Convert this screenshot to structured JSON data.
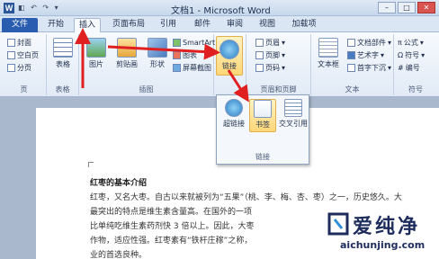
{
  "window": {
    "title": "文档1 - Microsoft Word",
    "app_icon": "W",
    "controls": [
      "–",
      "□",
      "✕"
    ]
  },
  "tabs": [
    {
      "label": "文件"
    },
    {
      "label": "开始"
    },
    {
      "label": "插入"
    },
    {
      "label": "页面布局"
    },
    {
      "label": "引用"
    },
    {
      "label": "邮件"
    },
    {
      "label": "审阅"
    },
    {
      "label": "视图"
    },
    {
      "label": "加载项"
    }
  ],
  "ribbon": {
    "pages_group": {
      "label": "页",
      "items": [
        "封面",
        "空白页",
        "分页"
      ]
    },
    "table_group": {
      "label": "表格",
      "button": "表格"
    },
    "illustrations_group": {
      "label": "插图",
      "buttons": [
        "图片",
        "剪贴画",
        "形状"
      ],
      "small": [
        "SmartArt",
        "图表",
        "屏幕截图"
      ]
    },
    "links_group": {
      "button": "链接"
    },
    "header_group": {
      "label": "页眉和页脚",
      "items": [
        "页眉",
        "页脚",
        "页码"
      ]
    },
    "text_group": {
      "label": "文本",
      "button": "文本框",
      "items": [
        "文档部件",
        "艺术字",
        "首字下沉"
      ]
    },
    "symbols_group": {
      "label": "符号",
      "items": [
        "公式",
        "符号",
        "编号"
      ]
    }
  },
  "links_dropdown": {
    "label": "链接",
    "buttons": [
      "超链接",
      "书签",
      "交叉引用"
    ]
  },
  "document": {
    "heading": "红枣的基本介绍",
    "lines": [
      "红枣，又名大枣。自古以来就被列为“五果”（桃、李、梅、杏、枣）之一，历史悠久。大",
      "最突出的特点是维生素含量高。在国外的一项",
      "比单纯吃维生素药剂快 3 倍以上。因此，大枣",
      "作物，适应性强。红枣素有“铁杆庄稼”之称，",
      "业的首选良种。"
    ]
  },
  "watermark": {
    "title": "爱纯净",
    "url": "aichunjing.com"
  }
}
